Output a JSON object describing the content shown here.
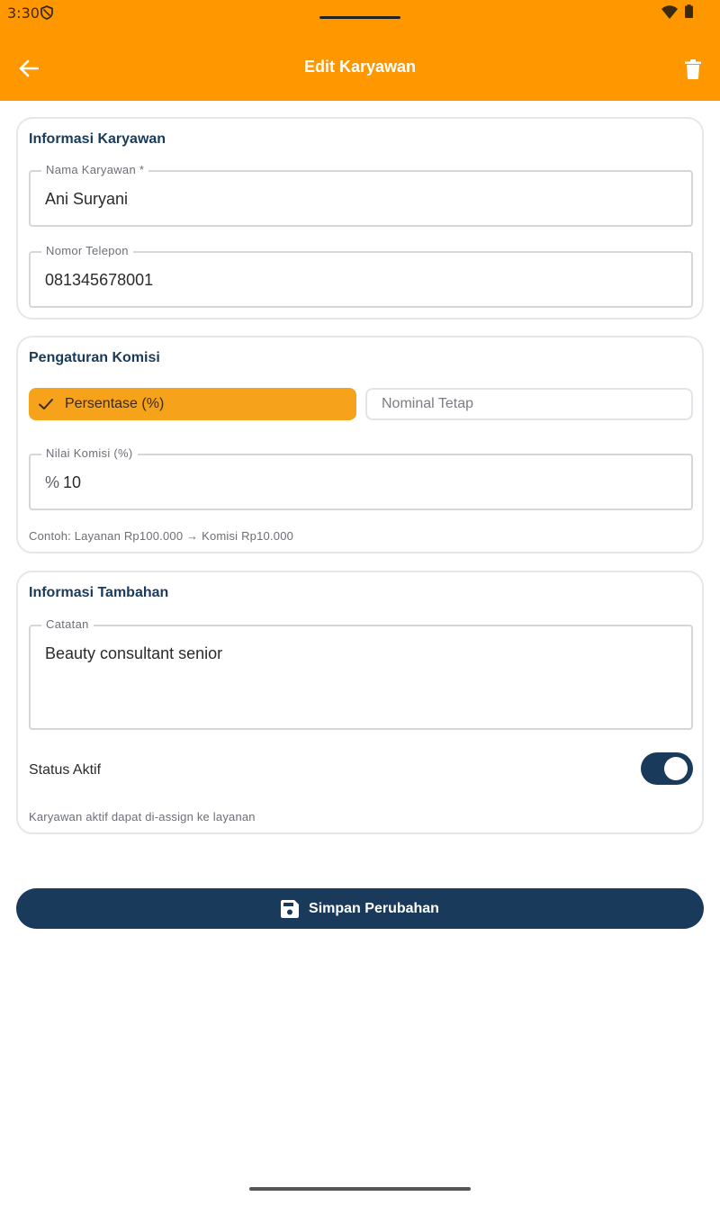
{
  "status_bar": {
    "time": "3:30"
  },
  "appbar": {
    "title": "Edit Karyawan",
    "color": "#ff9800"
  },
  "employee_info": {
    "title": "Informasi Karyawan",
    "name_label": "Nama Karyawan *",
    "name_value": "Ani Suryani",
    "phone_label": "Nomor Telepon",
    "phone_value": "081345678001"
  },
  "commission": {
    "title": "Pengaturan Komisi",
    "options": [
      {
        "label": "Persentase (%)",
        "selected": true
      },
      {
        "label": "Nominal Tetap",
        "selected": false
      }
    ],
    "value_label": "Nilai Komisi (%)",
    "prefix": "%",
    "value": "10",
    "example": "Contoh: Layanan Rp100.000 → Komisi Rp10.000"
  },
  "additional_info": {
    "title": "Informasi Tambahan",
    "notes_label": "Catatan",
    "notes_value": "Beauty consultant senior",
    "status_label": "Status Aktif",
    "status_active": true,
    "status_hint": "Karyawan aktif dapat di-assign ke layanan"
  },
  "save_button": {
    "label": "Simpan Perubahan"
  },
  "colors": {
    "primary": "#1a3a5c",
    "accent": "#ff9800",
    "segment_active": "#f7a21b"
  },
  "icons": [
    "shield-icon",
    "wifi-icon",
    "battery-icon",
    "back-arrow-icon",
    "trash-icon",
    "check-icon",
    "save-icon"
  ]
}
